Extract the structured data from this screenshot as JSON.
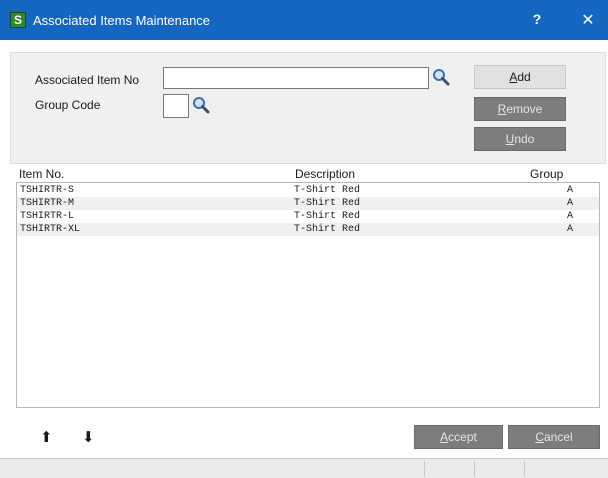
{
  "window": {
    "title": "Associated Items Maintenance",
    "app_icon_glyph": "S",
    "help_glyph": "?",
    "close_glyph": "✕"
  },
  "form": {
    "item_no_label": "Associated Item No",
    "item_no_value": "",
    "group_code_label": "Group Code",
    "group_code_value": "",
    "lookup_icon": "magnifier-icon"
  },
  "buttons": {
    "add": {
      "mnemonic": "A",
      "rest": "dd"
    },
    "remove": {
      "mnemonic": "R",
      "rest": "emove"
    },
    "undo": {
      "mnemonic": "U",
      "rest": "ndo"
    },
    "accept": {
      "mnemonic": "A",
      "rest": "ccept"
    },
    "cancel": {
      "mnemonic": "C",
      "rest": "ancel"
    }
  },
  "grid": {
    "columns": [
      "Item No.",
      "Description",
      "Group"
    ],
    "rows": [
      {
        "item": "TSHIRTR-S",
        "desc": "T-Shirt Red",
        "group": "A"
      },
      {
        "item": "TSHIRTR-M",
        "desc": "T-Shirt Red",
        "group": "A"
      },
      {
        "item": "TSHIRTR-L",
        "desc": "T-Shirt Red",
        "group": "A"
      },
      {
        "item": "TSHIRTR-XL",
        "desc": "T-Shirt Red",
        "group": "A"
      }
    ]
  },
  "nav": {
    "up_glyph": "⬆",
    "down_glyph": "⬇",
    "up_icon": "arrow-up-icon",
    "down_icon": "arrow-down-icon"
  },
  "colors": {
    "titlebar": "#1466c0",
    "disabled_button": "#7d7d7d",
    "panel": "#f0f0f0"
  }
}
